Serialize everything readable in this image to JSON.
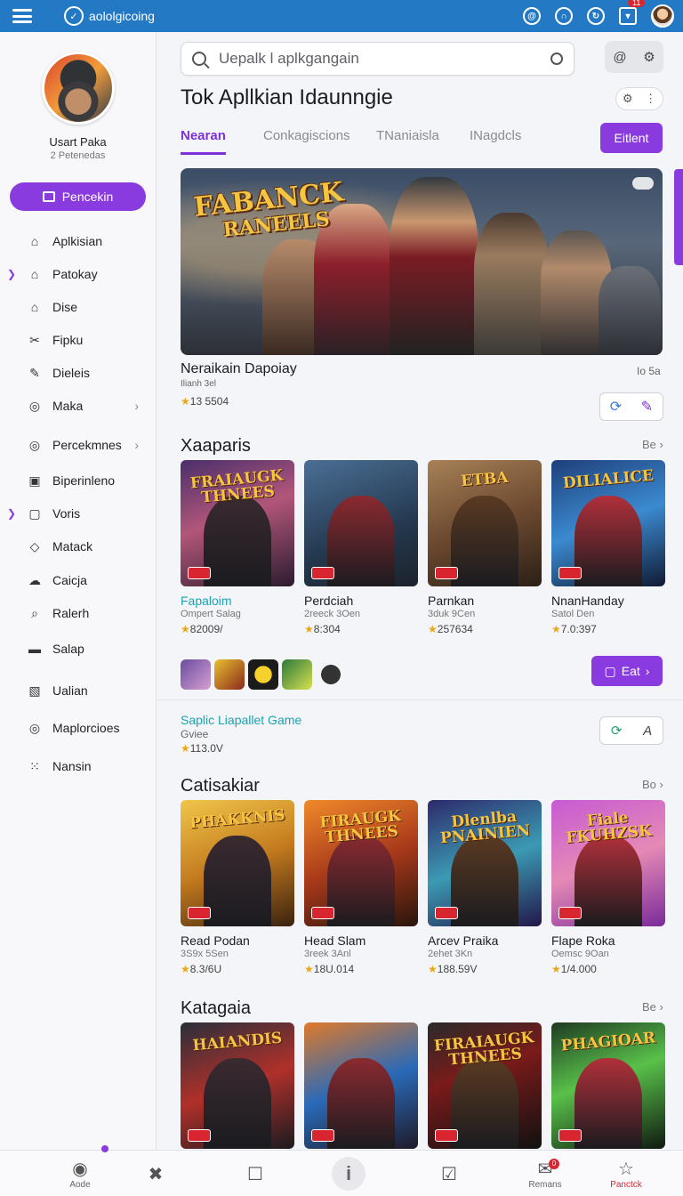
{
  "topbar": {
    "brand": "aololgicoing",
    "notification_count": "11"
  },
  "sidebar": {
    "profile_name": "Usart Paka",
    "profile_sub": "2 Petenedas",
    "button_label": "Pencekin",
    "items": [
      {
        "label": "Aplkisian",
        "icon": "home-icon",
        "glyph": "⌂",
        "marker": false,
        "chevron": false
      },
      {
        "label": "Patokay",
        "icon": "home-icon",
        "glyph": "⌂",
        "marker": true,
        "chevron": false
      },
      {
        "label": "Dise",
        "icon": "home-icon",
        "glyph": "⌂",
        "marker": false,
        "chevron": false
      },
      {
        "label": "Fipku",
        "icon": "tools-icon",
        "glyph": "✂",
        "marker": false,
        "chevron": false
      },
      {
        "label": "Dieleis",
        "icon": "tools-icon",
        "glyph": "✎",
        "marker": false,
        "chevron": false
      },
      {
        "label": "Maka",
        "icon": "target-icon",
        "glyph": "◎",
        "marker": false,
        "chevron": true
      },
      {
        "label": "Percekmnes",
        "icon": "target-icon",
        "glyph": "◎",
        "marker": false,
        "chevron": true
      },
      {
        "label": "Biperinleno",
        "icon": "toggle-icon",
        "glyph": "▣",
        "marker": false,
        "chevron": false
      },
      {
        "label": "Voris",
        "icon": "square-icon",
        "glyph": "▢",
        "marker": true,
        "chevron": false
      },
      {
        "label": "Matack",
        "icon": "diamond-icon",
        "glyph": "◇",
        "marker": false,
        "chevron": false
      },
      {
        "label": "Caicja",
        "icon": "cloud-icon",
        "glyph": "☁",
        "marker": false,
        "chevron": false
      },
      {
        "label": "Ralerh",
        "icon": "search-icon",
        "glyph": "⌕",
        "marker": false,
        "chevron": false
      },
      {
        "label": "Salap",
        "icon": "card-icon",
        "glyph": "▬",
        "marker": false,
        "chevron": false
      },
      {
        "label": "Ualian",
        "icon": "map-icon",
        "glyph": "▧",
        "marker": false,
        "chevron": false
      },
      {
        "label": "Maplorcioes",
        "icon": "target-icon",
        "glyph": "◎",
        "marker": false,
        "chevron": false
      },
      {
        "label": "Nansin",
        "icon": "grid-icon",
        "glyph": "⁙",
        "marker": false,
        "chevron": false
      }
    ]
  },
  "search": {
    "placeholder": "Uepalk l aplkgangain"
  },
  "page": {
    "title": "Tok Apllkian Idaunngie",
    "tabs": [
      "Nearan",
      "Conkagiscions",
      "TNaniaisla",
      "INagdcls"
    ],
    "edit_label": "Eitlent"
  },
  "hero": {
    "logo_line1": "FABANCK",
    "logo_line2": "RANEELS"
  },
  "featured": {
    "title": "Neraikain Dapoiay",
    "sub": "Ilianh 3el",
    "rating": "13 5504",
    "right_label": "Io 5a"
  },
  "sections": {
    "s1": {
      "title": "Xaaparis",
      "more": "Be",
      "cards": [
        {
          "name": "Fapaloim",
          "sub": "Ompert Salag",
          "rating": "82009/",
          "logo": "FRAIAUGK THNEES"
        },
        {
          "name": "Perdciah",
          "sub": "2reeck 3Oen",
          "rating": "8:304",
          "logo": ""
        },
        {
          "name": "Parnkan",
          "sub": "3duk 9Cen",
          "rating": "257634",
          "logo": "ETBA"
        },
        {
          "name": "NnanHanday",
          "sub": "Satol Den",
          "rating": "7.0:397",
          "logo": "DILIALICE"
        }
      ],
      "button_label": "Eat"
    },
    "promo": {
      "title": "Saplic Liapallet Game",
      "sub": "Gviee",
      "rating": "113.0V"
    },
    "s2": {
      "title": "Catisakiar",
      "more": "Bo",
      "cards": [
        {
          "name": "Read Podan",
          "sub": "3S9x 5Sen",
          "rating": "8.3/6U",
          "logo": "PHAKKNIS"
        },
        {
          "name": "Head Slam",
          "sub": "3reek 3Anl",
          "rating": "18U.014",
          "logo": "FIRAUGK THNEES"
        },
        {
          "name": "Arcev Praika",
          "sub": "2ehet 3Kn",
          "rating": "188.59V",
          "logo": "Dlenlba PNAINIEN"
        },
        {
          "name": "Flape Roka",
          "sub": "Oemsc 9Oan",
          "rating": "1/4.000",
          "logo": "Fiale FKUHZSK"
        }
      ]
    },
    "s3": {
      "title": "Katagaia",
      "more": "Be",
      "cards": [
        {
          "logo": "HAIANDIS"
        },
        {
          "logo": ""
        },
        {
          "logo": "FIRAIAUGK THNEES"
        },
        {
          "logo": "PHAGIOAR"
        }
      ]
    }
  },
  "bottom_nav": [
    {
      "label": "Aode",
      "icon": "home-icon",
      "glyph": "◉",
      "active": false
    },
    {
      "label": "",
      "icon": "close-icon",
      "glyph": "✖",
      "active": false
    },
    {
      "label": "",
      "icon": "square-icon",
      "glyph": "☐",
      "active": false
    },
    {
      "label": "",
      "icon": "info-icon",
      "glyph": "i",
      "active": false
    },
    {
      "label": "",
      "icon": "checkbox-icon",
      "glyph": "☑",
      "active": false
    },
    {
      "label": "Remans",
      "icon": "message-icon",
      "glyph": "✉",
      "active": false
    },
    {
      "label": "Panctck",
      "icon": "star-icon",
      "glyph": "☆",
      "active": true
    }
  ],
  "bottom_badge": "0",
  "colors": {
    "accent": "#8a3be0",
    "topbar": "#2379c4",
    "teal": "#1aa3b3",
    "alert": "#d9252f"
  }
}
